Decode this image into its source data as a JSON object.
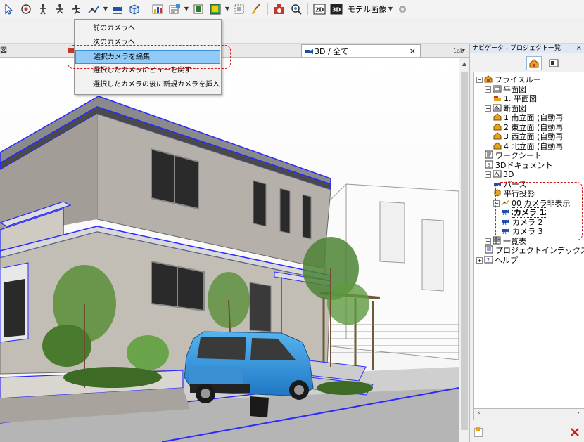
{
  "toolbar": {
    "icons": [
      "arrow-cursor-icon",
      "camera-orbit-icon",
      "camera-walk-icon",
      "camera-pan-icon",
      "camera-fly-icon",
      "camera-path-icon",
      "camera-list-icon",
      "object-view-icon",
      "fill-pattern-icon",
      "layer-combination-icon",
      "material-icon",
      "select-box-icon",
      "brush-icon",
      "render-icon",
      "zoom-icon"
    ],
    "btn_2d": "2D",
    "btn_3d": "3D",
    "model_image_label": "モデル画像"
  },
  "tabs": {
    "left_fragment": "図",
    "active_tab_label": "3D / 全て",
    "close_glyph": "×"
  },
  "camera_menu": {
    "items": [
      {
        "label": "前のカメラへ"
      },
      {
        "label": "次のカメラへ"
      },
      {
        "label": "選択カメラを編集"
      },
      {
        "label": "選択したカメラにビューを戻す"
      },
      {
        "label": "選択したカメラの後に新規カメラを挿入"
      }
    ],
    "highlighted_index": 2
  },
  "navigator": {
    "title": "ナビゲータ - プロジェクト一覧",
    "close_glyph": "×",
    "tree": [
      {
        "label": "フライスルー",
        "level": 0,
        "expander": "−",
        "icon": "project-icon"
      },
      {
        "label": "平面図",
        "level": 1,
        "expander": "−",
        "icon": "floorplan-folder-icon"
      },
      {
        "label": "1. 平面図",
        "level": 2,
        "expander": "",
        "icon": "floor-icon"
      },
      {
        "label": "断面図",
        "level": 1,
        "expander": "−",
        "icon": "section-folder-icon"
      },
      {
        "label": "1 南立面 (自動再",
        "level": 2,
        "expander": "",
        "icon": "elevation-icon"
      },
      {
        "label": "2 東立面 (自動再",
        "level": 2,
        "expander": "",
        "icon": "elevation-icon"
      },
      {
        "label": "3 西立面 (自動再",
        "level": 2,
        "expander": "",
        "icon": "elevation-icon"
      },
      {
        "label": "4 北立面 (自動再",
        "level": 2,
        "expander": "",
        "icon": "elevation-icon"
      },
      {
        "label": "ワークシート",
        "level": 1,
        "expander": "",
        "icon": "worksheet-icon"
      },
      {
        "label": "3Dドキュメント",
        "level": 1,
        "expander": "",
        "icon": "3d-document-icon"
      },
      {
        "label": "3D",
        "level": 1,
        "expander": "−",
        "icon": "3d-folder-icon"
      },
      {
        "label": "パース",
        "level": 2,
        "expander": "",
        "icon": "perspective-icon"
      },
      {
        "label": "平行投影",
        "level": 2,
        "expander": "",
        "icon": "parallel-icon"
      },
      {
        "label": "00 カメラ非表示",
        "level": 2,
        "expander": "−",
        "icon": "camera-path-icon"
      },
      {
        "label": "カメラ 1",
        "level": 3,
        "expander": "",
        "icon": "camera-icon",
        "bold": true
      },
      {
        "label": "カメラ 2",
        "level": 3,
        "expander": "",
        "icon": "camera-icon"
      },
      {
        "label": "カメラ 3",
        "level": 3,
        "expander": "",
        "icon": "camera-icon"
      },
      {
        "label": "一覧表",
        "level": 1,
        "expander": "+",
        "icon": "schedule-icon"
      },
      {
        "label": "プロジェクトインデックス",
        "level": 1,
        "expander": "",
        "icon": "index-icon"
      },
      {
        "label": "ヘルプ",
        "level": 0,
        "expander": "+",
        "icon": "help-icon"
      }
    ]
  },
  "colors": {
    "highlight_red": "#d21c1c",
    "menu_highlight": "#91c9f7",
    "outline_blue": "#2a2aff",
    "car_blue": "#2a8fd8"
  }
}
